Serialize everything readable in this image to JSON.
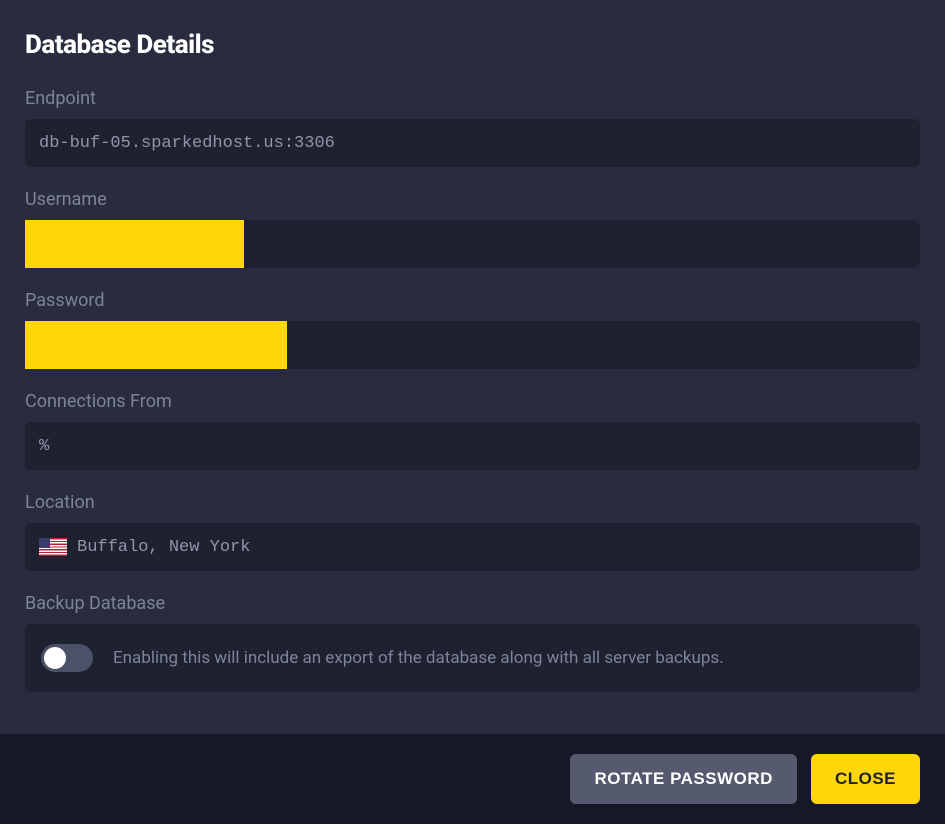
{
  "modal": {
    "title": "Database Details",
    "fields": {
      "endpoint": {
        "label": "Endpoint",
        "value": "db-buf-05.sparkedhost.us:3306"
      },
      "username": {
        "label": "Username",
        "value": ""
      },
      "password": {
        "label": "Password",
        "value": ""
      },
      "connections": {
        "label": "Connections From",
        "value": "%"
      },
      "location": {
        "label": "Location",
        "value": "Buffalo, New York",
        "flag": "us"
      },
      "backup": {
        "label": "Backup Database",
        "description": "Enabling this will include an export of the database along with all server backups.",
        "enabled": false
      }
    },
    "buttons": {
      "rotate": "ROTATE PASSWORD",
      "close": "CLOSE"
    }
  },
  "colors": {
    "accent": "#ffd608",
    "background": "#282c3e",
    "fieldBg": "#1e2130",
    "footerBg": "#161925"
  }
}
